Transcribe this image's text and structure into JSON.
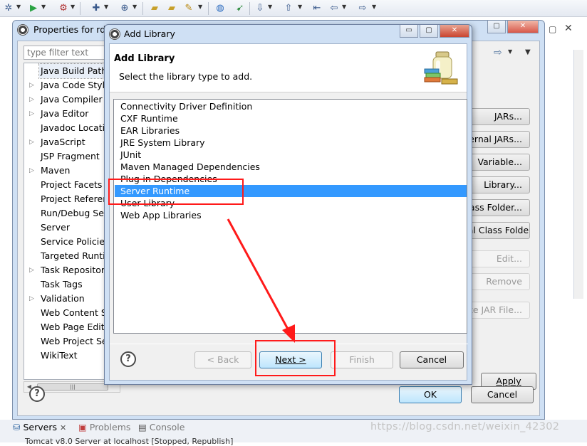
{
  "properties_window": {
    "title": "Properties for rdb",
    "filter_placeholder": "type filter text",
    "tree_items": [
      {
        "label": "Java Build Path",
        "expandable": false,
        "selected": true
      },
      {
        "label": "Java Code Style",
        "expandable": true
      },
      {
        "label": "Java Compiler",
        "expandable": true
      },
      {
        "label": "Java Editor",
        "expandable": true
      },
      {
        "label": "Javadoc Location",
        "expandable": false
      },
      {
        "label": "JavaScript",
        "expandable": true
      },
      {
        "label": "JSP Fragment",
        "expandable": false
      },
      {
        "label": "Maven",
        "expandable": true
      },
      {
        "label": "Project Facets",
        "expandable": false
      },
      {
        "label": "Project References",
        "expandable": false
      },
      {
        "label": "Run/Debug Settings",
        "expandable": false
      },
      {
        "label": "Server",
        "expandable": false
      },
      {
        "label": "Service Policies",
        "expandable": false
      },
      {
        "label": "Targeted Runtimes",
        "expandable": false
      },
      {
        "label": "Task Repository",
        "expandable": true
      },
      {
        "label": "Task Tags",
        "expandable": false
      },
      {
        "label": "Validation",
        "expandable": true
      },
      {
        "label": "Web Content Settings",
        "expandable": false
      },
      {
        "label": "Web Page Editor",
        "expandable": false
      },
      {
        "label": "Web Project Settings",
        "expandable": false
      },
      {
        "label": "WikiText",
        "expandable": false
      }
    ],
    "side_buttons": [
      {
        "label": "JARs...",
        "enabled": true
      },
      {
        "label": "External JARs...",
        "enabled": true
      },
      {
        "label": "Variable...",
        "enabled": true
      },
      {
        "label": "Library...",
        "enabled": true
      },
      {
        "label": "Class Folder...",
        "enabled": true
      },
      {
        "label": "External Class Folder...",
        "enabled": true
      },
      {
        "label": "Edit...",
        "enabled": false
      },
      {
        "label": "Remove",
        "enabled": false
      },
      {
        "label": "Migrate JAR File...",
        "enabled": false
      }
    ],
    "apply_label": "Apply",
    "ok_label": "OK",
    "cancel_label": "Cancel",
    "help_glyph": "?"
  },
  "dialog": {
    "title": "Add Library",
    "heading": "Add Library",
    "description": "Select the library type to add.",
    "library_types": [
      "Connectivity Driver Definition",
      "CXF Runtime",
      "EAR Libraries",
      "JRE System Library",
      "JUnit",
      "Maven Managed Dependencies",
      "Plug-in Dependencies",
      "Server Runtime",
      "User Library",
      "Web App Libraries"
    ],
    "selected_index": 7,
    "back_label": "< Back",
    "next_label": "Next >",
    "finish_label": "Finish",
    "cancel_label": "Cancel",
    "help_glyph": "?",
    "window_buttons": {
      "minimize": "▭",
      "maximize": "▢",
      "close": "✕"
    }
  },
  "bottom_views": {
    "tabs": [
      {
        "label": "Servers",
        "icon": "servers-icon",
        "active": true
      },
      {
        "label": "Problems",
        "icon": "problems-icon",
        "active": false
      },
      {
        "label": "Console",
        "icon": "console-icon",
        "active": false
      }
    ],
    "server_entry": "Tomcat v8.0 Server at localhost  [Stopped, Republish]"
  },
  "watermark": "https://blog.csdn.net/weixin_42302",
  "colors": {
    "selection": "#3399ff",
    "annotation_red": "#ff1a1a",
    "window_frame": "#cfe0f4"
  }
}
